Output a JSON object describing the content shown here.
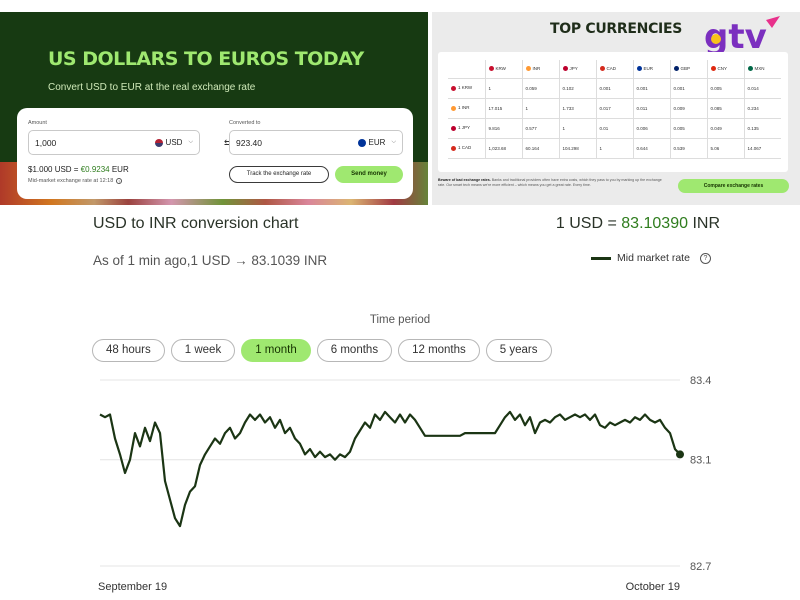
{
  "converter": {
    "title": "US DOLLARS TO EUROS TODAY",
    "subtitle": "Convert USD to EUR at the real exchange rate",
    "amount_label": "Amount",
    "amount_value": "1,000",
    "from_currency": "USD",
    "converted_label": "Converted to",
    "converted_value": "923.40",
    "to_currency": "EUR",
    "rate_prefix": "$1.000 USD = ",
    "rate_value": "€0.9234",
    "rate_suffix": " EUR",
    "rate_note": "Mid-market exchange rate at 12:18",
    "track_label": "Track the exchange rate",
    "send_label": "Send money"
  },
  "currencies": {
    "title": "TOP CURRENCIES",
    "headers": [
      "",
      "KRW",
      "INR",
      "JPY",
      "CAD",
      "EUR",
      "GBP",
      "CNY",
      "MXN"
    ],
    "rows": [
      [
        "1 KRW",
        "1",
        "0.059",
        "0.102",
        "0.001",
        "0.001",
        "0.001",
        "0.005",
        "0.014"
      ],
      [
        "1 INR",
        "17.015",
        "1",
        "1.733",
        "0.017",
        "0.011",
        "0.009",
        "0.085",
        "0.234"
      ],
      [
        "1 JPY",
        "9.816",
        "0.577",
        "1",
        "0.01",
        "0.006",
        "0.005",
        "0.049",
        "0.135"
      ],
      [
        "1 CAD",
        "1,023.68",
        "60.164",
        "104.298",
        "1",
        "0.644",
        "0.539",
        "5.06",
        "14.067"
      ]
    ],
    "flag_colors": [
      "#c8102e",
      "#ff9933",
      "#bc002d",
      "#d52b1e",
      "#003399",
      "#012169",
      "#de2910",
      "#006847"
    ],
    "warning_bold": "Beware of bad exchange rates.",
    "warning_text": " Banks and traditional providers often have extra costs, which they pass to you by marking up the exchange rate. Our smart tech means we're more efficient – which means you get a great rate. Every time.",
    "compare_label": "Compare exchange rates"
  },
  "logo_text": "gtv",
  "chart_header": {
    "title": "USD to INR conversion chart",
    "rate_prefix": "1 USD = ",
    "rate_value": "83.10390",
    "rate_suffix": " INR",
    "as_of": "As of 1 min ago,1 USD → 83.1039 INR",
    "legend_label": "Mid market rate",
    "period_label": "Time period",
    "periods": [
      "48 hours",
      "1 week",
      "1 month",
      "6 months",
      "12 months",
      "5 years"
    ],
    "active_period": "1 month"
  },
  "chart_data": {
    "type": "line",
    "series": [
      {
        "name": "Mid market rate",
        "color": "#1b3514",
        "values": [
          83.27,
          83.26,
          83.27,
          83.18,
          83.12,
          83.05,
          83.1,
          83.2,
          83.15,
          83.22,
          83.17,
          83.24,
          83.2,
          83.02,
          82.95,
          82.88,
          82.85,
          82.93,
          82.98,
          83.0,
          83.08,
          83.12,
          83.15,
          83.18,
          83.16,
          83.2,
          83.22,
          83.18,
          83.2,
          83.24,
          83.27,
          83.25,
          83.27,
          83.24,
          83.26,
          83.22,
          83.25,
          83.2,
          83.22,
          83.18,
          83.16,
          83.12,
          83.14,
          83.11,
          83.13,
          83.11,
          83.12,
          83.1,
          83.12,
          83.11,
          83.13,
          83.18,
          83.21,
          83.24,
          83.22,
          83.27,
          83.25,
          83.28,
          83.26,
          83.24,
          83.27,
          83.24,
          83.27,
          83.25,
          83.22,
          83.19,
          83.19,
          83.19,
          83.19,
          83.19,
          83.19,
          83.19,
          83.19,
          83.2,
          83.2,
          83.2,
          83.2,
          83.2,
          83.2,
          83.2,
          83.23,
          83.26,
          83.28,
          83.25,
          83.27,
          83.23,
          83.26,
          83.2,
          83.24,
          83.25,
          83.24,
          83.26,
          83.27,
          83.25,
          83.26,
          83.27,
          83.26,
          83.27,
          83.25,
          83.27,
          83.23,
          83.22,
          83.24,
          83.23,
          83.24,
          83.25,
          83.24,
          83.26,
          83.25,
          83.27,
          83.25,
          83.24,
          83.25,
          83.22,
          83.2,
          83.14,
          83.12
        ]
      }
    ],
    "x_start_label": "September 19",
    "x_end_label": "October 19",
    "y_ticks": [
      "83.4",
      "83.1",
      "82.7"
    ],
    "ylim": [
      82.7,
      83.4
    ],
    "grid": true
  }
}
